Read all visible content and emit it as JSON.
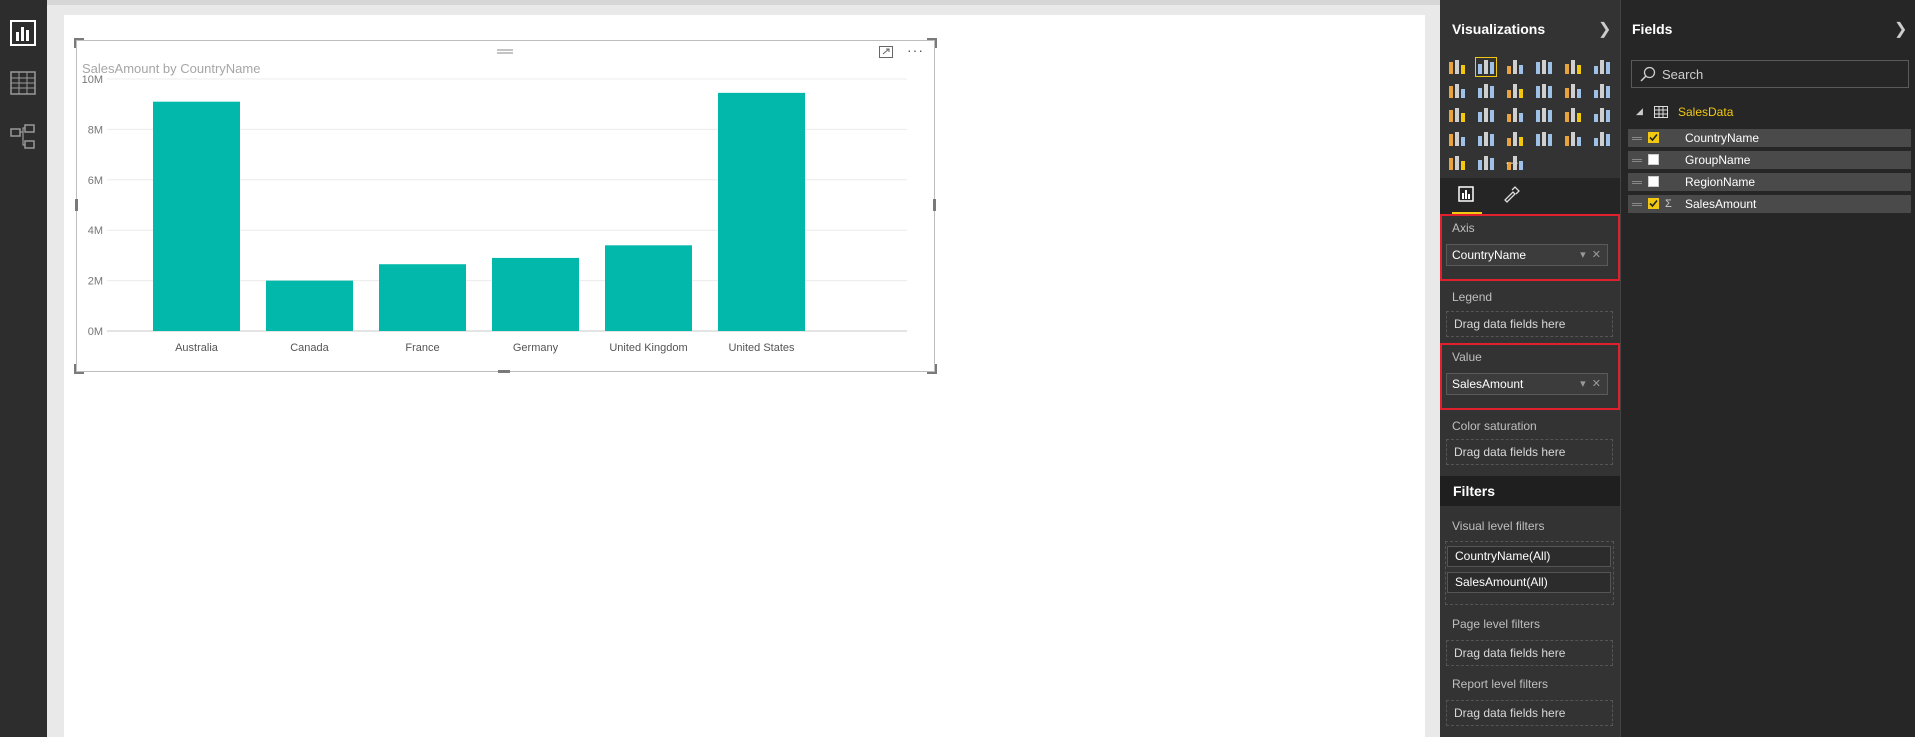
{
  "visual": {
    "title": "SalesAmount by CountryName"
  },
  "chart_data": {
    "type": "bar",
    "title": "SalesAmount by CountryName",
    "xlabel": "",
    "ylabel": "",
    "categories": [
      "Australia",
      "Canada",
      "France",
      "Germany",
      "United Kingdom",
      "United States"
    ],
    "series": [
      {
        "values": [
          9.1,
          2.0,
          2.65,
          2.9,
          3.4,
          9.45
        ]
      }
    ],
    "value_unit_suffix": "M",
    "ylim": [
      0,
      10
    ],
    "yticks": [
      "0M",
      "2M",
      "4M",
      "6M",
      "8M",
      "10M"
    ],
    "grid": true,
    "bar_color": "#01b8aa"
  },
  "visualizations": {
    "title": "Visualizations",
    "wells": {
      "axis_label": "Axis",
      "axis_field": "CountryName",
      "legend_label": "Legend",
      "legend_placeholder": "Drag data fields here",
      "value_label": "Value",
      "value_field": "SalesAmount",
      "color_saturation_label": "Color saturation",
      "color_saturation_placeholder": "Drag data fields here"
    },
    "more": "···"
  },
  "filters": {
    "title": "Filters",
    "visual_level_label": "Visual level filters",
    "visual_level_items": [
      "CountryName(All)",
      "SalesAmount(All)"
    ],
    "page_level_label": "Page level filters",
    "page_level_placeholder": "Drag data fields here",
    "report_level_label": "Report level filters",
    "report_level_placeholder": "Drag data fields here"
  },
  "fields": {
    "title": "Fields",
    "search_placeholder": "Search",
    "table_name": "SalesData",
    "items": [
      {
        "name": "CountryName",
        "checked": true,
        "sigma": false
      },
      {
        "name": "GroupName",
        "checked": false,
        "sigma": false
      },
      {
        "name": "RegionName",
        "checked": false,
        "sigma": false
      },
      {
        "name": "SalesAmount",
        "checked": true,
        "sigma": true
      }
    ]
  },
  "colors": {
    "accent": "#f2c811",
    "highlight_box": "#e0202c"
  }
}
